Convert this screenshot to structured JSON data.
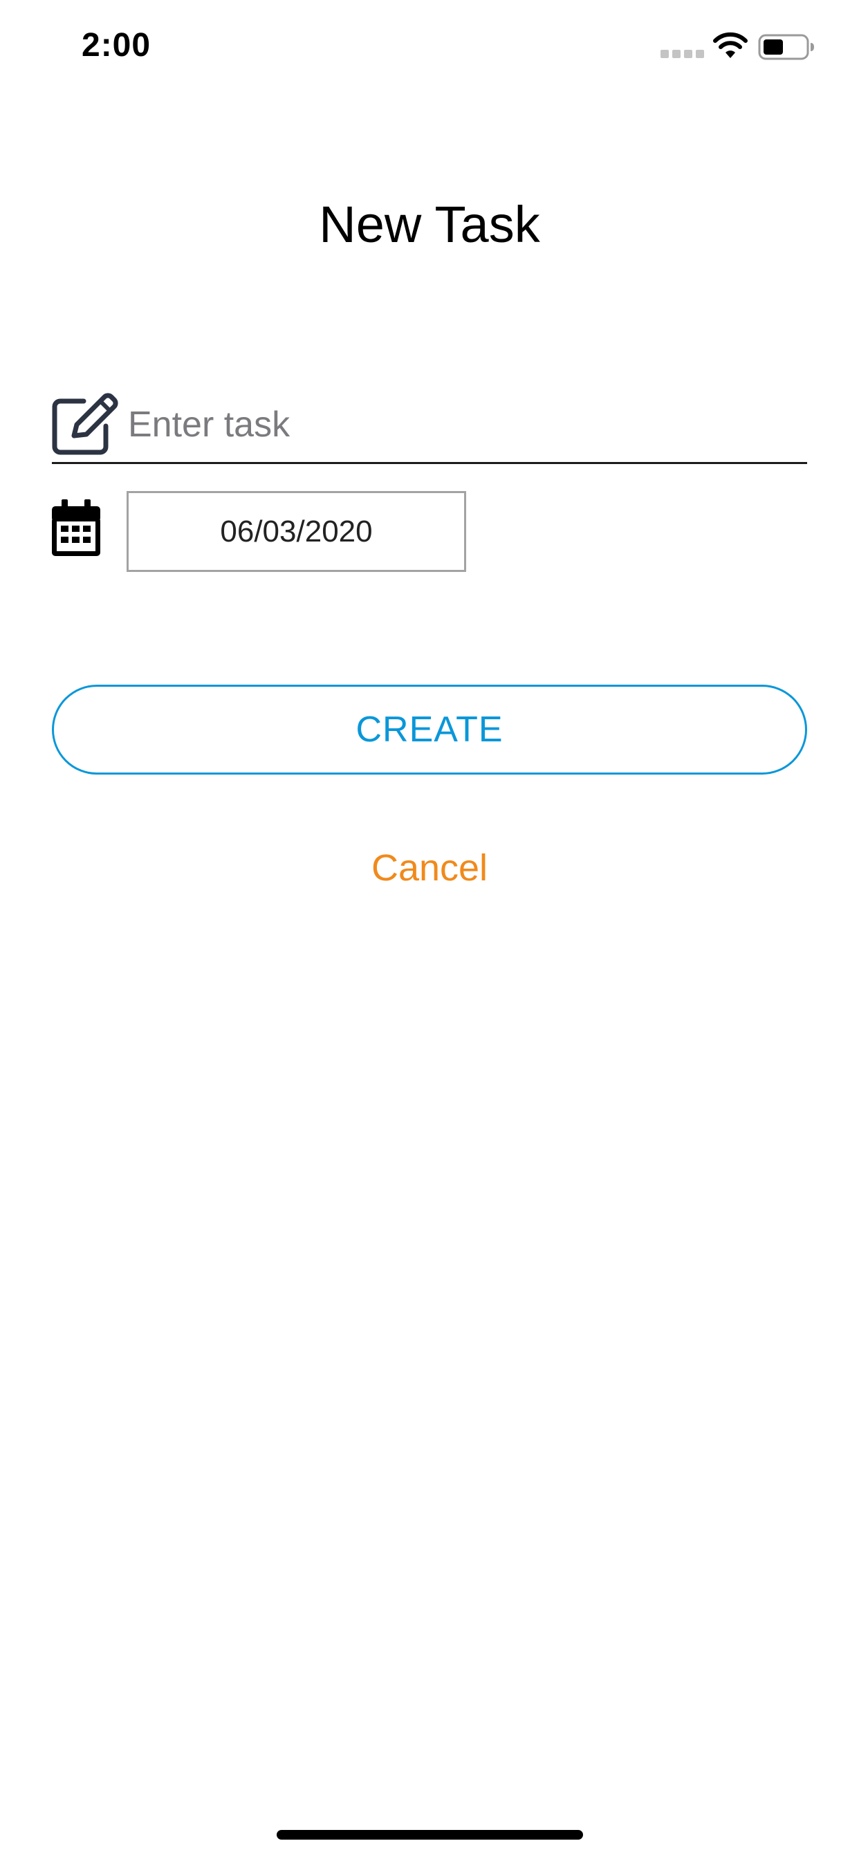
{
  "status_bar": {
    "time": "2:00",
    "icons": [
      "signal-icon",
      "wifi-icon",
      "battery-icon"
    ]
  },
  "page": {
    "title": "New Task"
  },
  "task_field": {
    "icon": "edit-icon",
    "placeholder": "Enter task",
    "value": ""
  },
  "date_field": {
    "icon": "calendar-icon",
    "value": "06/03/2020"
  },
  "actions": {
    "create_label": "CREATE",
    "cancel_label": "Cancel"
  },
  "colors": {
    "accent_blue": "#0a97d9",
    "cancel_orange": "#f08a1c",
    "icon_dark": "#2c3342"
  }
}
